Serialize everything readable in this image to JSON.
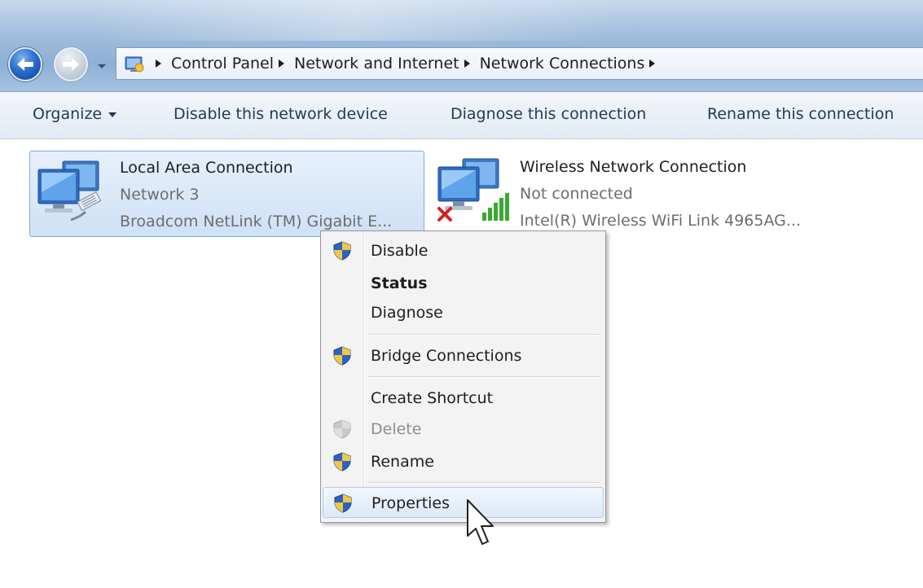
{
  "address_bar": {
    "crumbs": [
      "Control Panel",
      "Network and Internet",
      "Network Connections"
    ]
  },
  "toolbar": {
    "organize": "Organize",
    "disable_device": "Disable this network device",
    "diagnose": "Diagnose this connection",
    "rename": "Rename this connection"
  },
  "connections": [
    {
      "name": "Local Area Connection",
      "status": "Network  3",
      "device": "Broadcom NetLink (TM) Gigabit E...",
      "selected": true
    },
    {
      "name": "Wireless Network Connection",
      "status": "Not connected",
      "device": "Intel(R) Wireless WiFi Link 4965AG...",
      "selected": false
    }
  ],
  "context_menu": {
    "items": [
      {
        "label": "Disable",
        "icon": "shield-icon"
      },
      {
        "label": "Status",
        "bold": true
      },
      {
        "label": "Diagnose"
      },
      {
        "label": "Bridge Connections",
        "icon": "shield-icon"
      },
      {
        "label": "Create Shortcut"
      },
      {
        "label": "Delete",
        "icon": "shield-icon",
        "disabled": true
      },
      {
        "label": "Rename",
        "icon": "shield-icon"
      },
      {
        "label": "Properties",
        "icon": "shield-icon",
        "hovered": true
      }
    ]
  },
  "colors": {
    "selection_fill": "#cfe1f6",
    "selection_border": "#84acdd",
    "error_x": "#d62020",
    "signal_green": "#3aa832"
  }
}
